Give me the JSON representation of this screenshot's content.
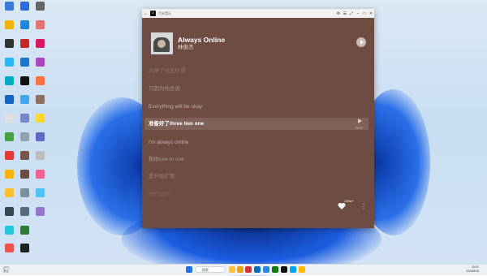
{
  "window": {
    "title": "汽水音乐",
    "back": "←",
    "controls": [
      "⚙",
      "☰",
      "⤢",
      "–",
      "□",
      "✕"
    ]
  },
  "song": {
    "title": "Always Online",
    "artist": "林俊杰"
  },
  "lyrics": [
    "风停了也无所谓",
    "只因为你总说",
    "Everything will be okay",
    "准备好了three two one",
    "I'm always online",
    "和你one to one",
    "爱开始扩散",
    "他们说你"
  ],
  "current_line_time": "00:47",
  "favorite_count": "100w+",
  "taskbar": {
    "search_label": "搜索",
    "weather": [
      "27°C",
      "多云"
    ],
    "clock_time": "15:51",
    "clock_date": "2024/8/15"
  },
  "colors": {
    "window_bg": "#6e4c41",
    "accent_highlight": "#ffffff"
  }
}
